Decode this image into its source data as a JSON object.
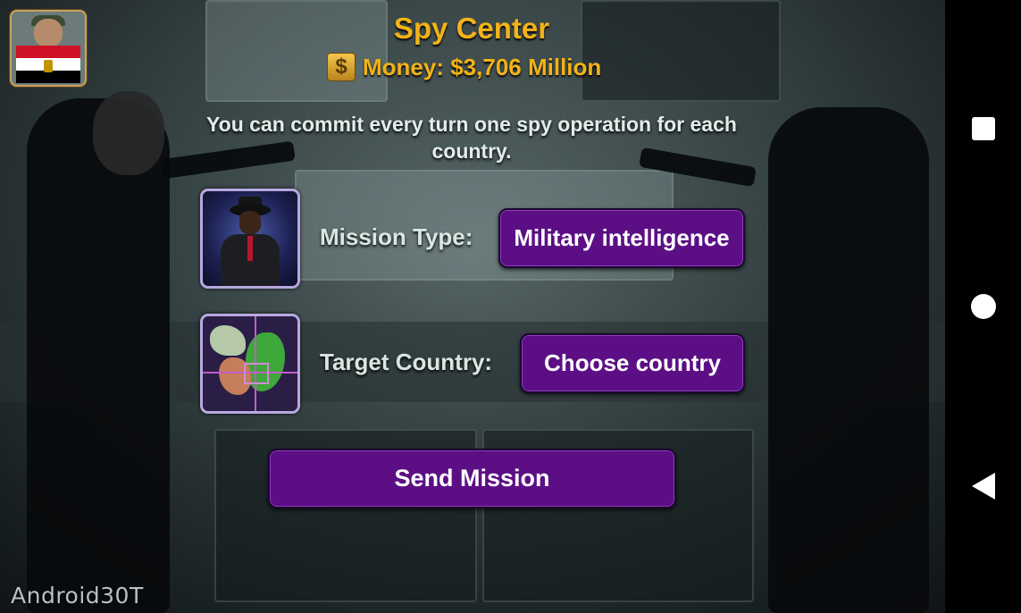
{
  "header": {
    "title": "Spy Center",
    "money_symbol": "$",
    "money_text": "Money: $3,706 Million"
  },
  "player": {
    "avatar_icon": "soldier-portrait",
    "flag": "egypt-flag"
  },
  "info_text": "You can commit every turn one spy operation for each country.",
  "mission": {
    "label": "Mission Type:",
    "value": "Military intelligence",
    "icon": "spy-agent-icon"
  },
  "target": {
    "label": "Target Country:",
    "value": "Choose country",
    "icon": "target-map-icon"
  },
  "send_button": "Send Mission",
  "watermark": "Android30T",
  "colors": {
    "accent_gold": "#f2b318",
    "button_purple": "#5c0f85",
    "card_border": "#b7a8e0"
  },
  "system_nav": {
    "recent_icon": "square-icon",
    "home_icon": "circle-icon",
    "back_icon": "triangle-back-icon"
  }
}
